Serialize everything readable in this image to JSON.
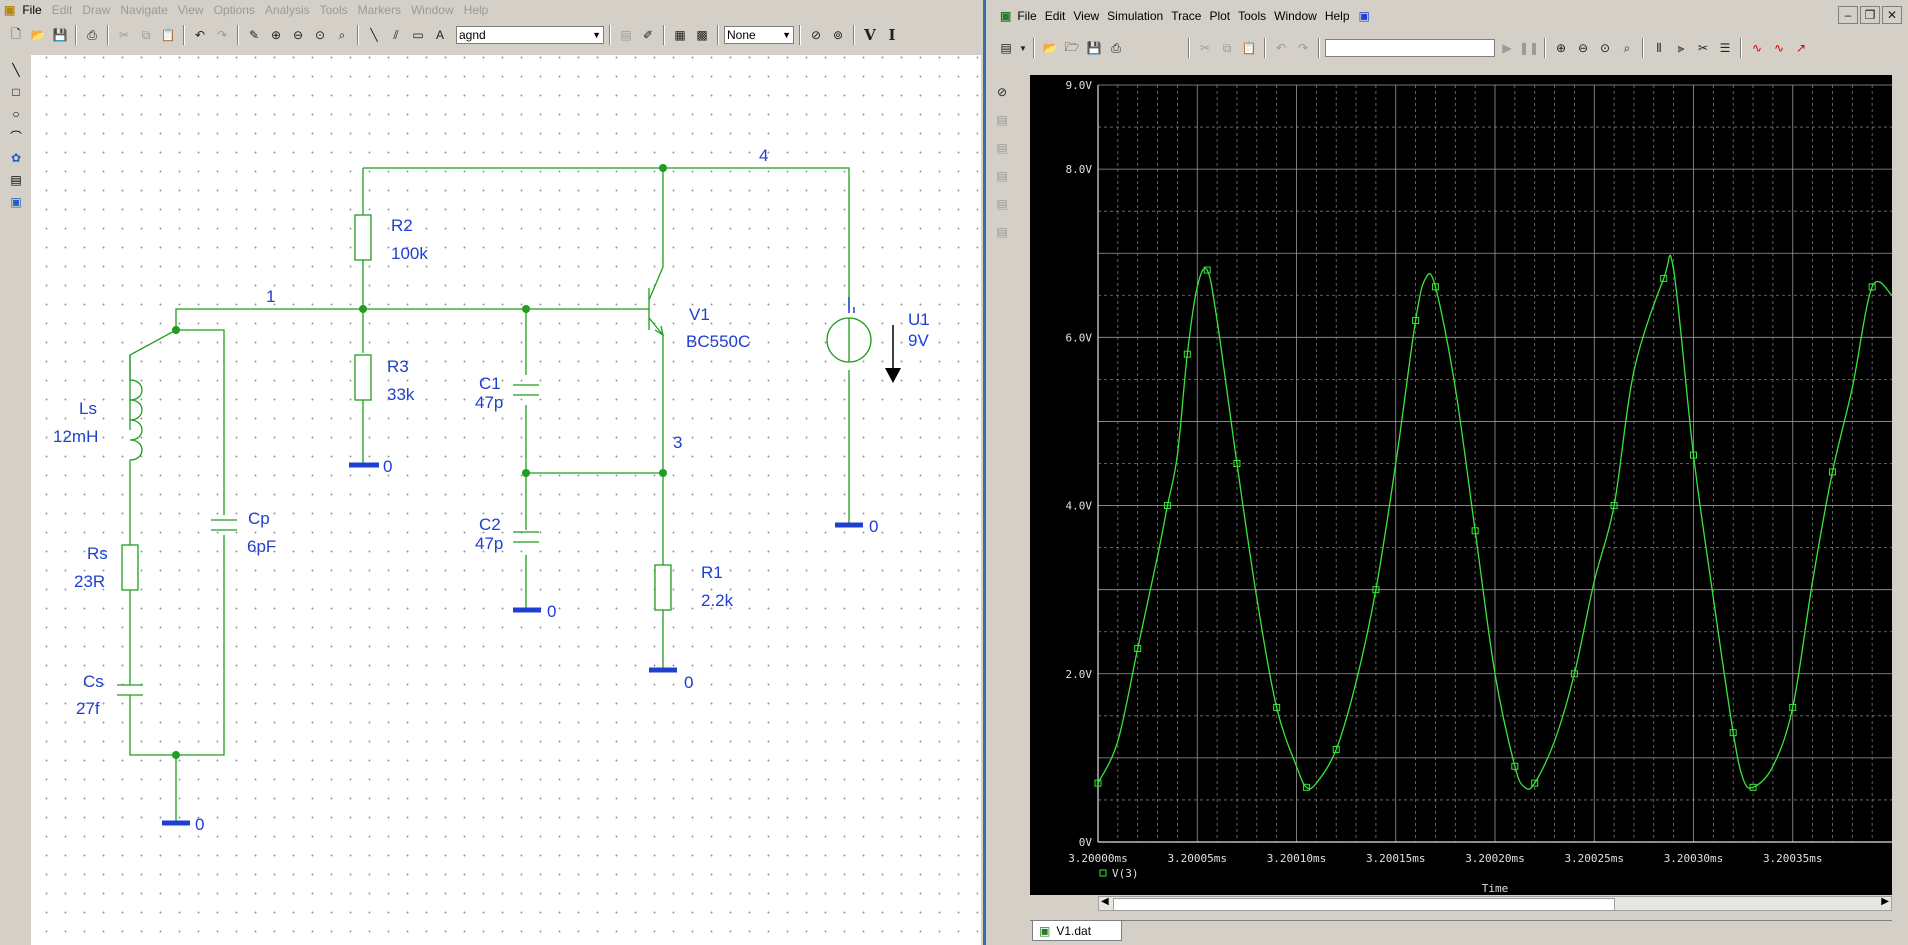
{
  "left_app": {
    "menu": [
      {
        "label": "File",
        "disabled": false
      },
      {
        "label": "Edit",
        "disabled": true
      },
      {
        "label": "Draw",
        "disabled": true
      },
      {
        "label": "Navigate",
        "disabled": true
      },
      {
        "label": "View",
        "disabled": true
      },
      {
        "label": "Options",
        "disabled": true
      },
      {
        "label": "Analysis",
        "disabled": true
      },
      {
        "label": "Tools",
        "disabled": true
      },
      {
        "label": "Markers",
        "disabled": true
      },
      {
        "label": "Window",
        "disabled": true
      },
      {
        "label": "Help",
        "disabled": true
      }
    ],
    "part_combo_value": "agnd",
    "zoom_combo_value": "None",
    "text_tool_label": "V",
    "text_tool2_label": "I"
  },
  "schematic": {
    "nodes": {
      "n1": "1",
      "n3": "3",
      "n4": "4"
    },
    "ground_label": "0",
    "components": {
      "R2": {
        "name": "R2",
        "value": "100k"
      },
      "R3": {
        "name": "R3",
        "value": "33k"
      },
      "C1": {
        "name": "C1",
        "value": "47p"
      },
      "C2": {
        "name": "C2",
        "value": "47p"
      },
      "R1": {
        "name": "R1",
        "value": "2.2k"
      },
      "V1": {
        "name": "V1",
        "value": "BC550C"
      },
      "U1": {
        "name": "U1",
        "value": "9V"
      },
      "Ls": {
        "name": "Ls",
        "value": "12mH"
      },
      "Rs": {
        "name": "Rs",
        "value": "23R"
      },
      "Cs": {
        "name": "Cs",
        "value": "27f"
      },
      "Cp": {
        "name": "Cp",
        "value": "6pF"
      }
    }
  },
  "right_app": {
    "menu": [
      "File",
      "Edit",
      "View",
      "Simulation",
      "Trace",
      "Plot",
      "Tools",
      "Window",
      "Help"
    ],
    "tab_label": "V1.dat"
  },
  "chart_data": {
    "type": "line",
    "title": "",
    "xlabel": "Time",
    "ylabel": "",
    "xlim": [
      3.2,
      3.2004
    ],
    "ylim": [
      0,
      9
    ],
    "x_unit": "ms",
    "x_ticks": [
      "3.20000ms",
      "3.20005ms",
      "3.20010ms",
      "3.20015ms",
      "3.20020ms",
      "3.20025ms",
      "3.20030ms",
      "3.20035ms"
    ],
    "y_ticks": [
      "0V",
      "2.0V",
      "4.0V",
      "6.0V",
      "8.0V",
      "9.0V"
    ],
    "series": [
      {
        "name": "V(3)",
        "color": "#39e639",
        "x": [
          3.2,
          3.20001,
          3.20002,
          3.20003,
          3.200035,
          3.20004,
          3.200045,
          3.20005,
          3.200055,
          3.20006,
          3.20007,
          3.20008,
          3.20009,
          3.2001,
          3.200105,
          3.20011,
          3.20012,
          3.20013,
          3.20014,
          3.20015,
          3.20016,
          3.200165,
          3.20017,
          3.20018,
          3.20019,
          3.2002,
          3.20021,
          3.200215,
          3.20022,
          3.20023,
          3.20024,
          3.20025,
          3.20026,
          3.20027,
          3.200285,
          3.20029,
          3.2003,
          3.20031,
          3.20032,
          3.200325,
          3.20033,
          3.20034,
          3.20035,
          3.20036,
          3.20037,
          3.20038,
          3.20039,
          3.2004
        ],
        "y": [
          0.7,
          1.2,
          2.3,
          3.4,
          4.0,
          4.6,
          5.8,
          6.6,
          6.8,
          6.2,
          4.5,
          2.9,
          1.6,
          0.9,
          0.65,
          0.7,
          1.1,
          1.9,
          3.0,
          4.5,
          6.2,
          6.7,
          6.6,
          5.4,
          3.7,
          2.0,
          0.9,
          0.65,
          0.7,
          1.2,
          2.0,
          3.1,
          4.0,
          5.6,
          6.7,
          6.8,
          4.6,
          2.9,
          1.3,
          0.75,
          0.65,
          0.9,
          1.6,
          3.1,
          4.4,
          5.4,
          6.6,
          6.5
        ]
      }
    ],
    "grid": true,
    "legend_position": "bottom-left"
  }
}
